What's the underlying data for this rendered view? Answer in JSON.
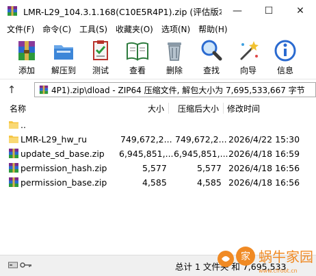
{
  "window": {
    "title": "LMR-L29_104.3.1.168(C10E5R4P1).zip (评估版本)",
    "minimize_glyph": "—",
    "maximize_glyph": "☐",
    "close_glyph": "✕"
  },
  "menu": [
    {
      "label": "文件(F)"
    },
    {
      "label": "命令(C)"
    },
    {
      "label": "工具(S)"
    },
    {
      "label": "收藏夹(O)"
    },
    {
      "label": "选项(N)"
    },
    {
      "label": "帮助(H)"
    }
  ],
  "toolbar": [
    {
      "label": "添加",
      "icon": "add-archive-icon"
    },
    {
      "label": "解压到",
      "icon": "extract-to-icon"
    },
    {
      "label": "测试",
      "icon": "test-icon"
    },
    {
      "label": "查看",
      "icon": "view-icon"
    },
    {
      "label": "删除",
      "icon": "delete-icon"
    },
    {
      "label": "查找",
      "icon": "find-icon"
    },
    {
      "label": "向导",
      "icon": "wizard-icon"
    },
    {
      "label": "信息",
      "icon": "info-icon"
    }
  ],
  "address": {
    "up_glyph": "↑",
    "path": "4P1).zip\\dload - ZIP64 压缩文件, 解包大小为 7,695,533,667 字节"
  },
  "columns": {
    "name": "名称",
    "size": "大小",
    "packed": "压缩后大小",
    "modified": "修改时间"
  },
  "files": [
    {
      "name": "..",
      "size": "",
      "packed": "",
      "modified": "",
      "type": "parent-folder"
    },
    {
      "name": "LMR-L29_hw_ru",
      "size": "749,672,2...",
      "packed": "749,672,2...",
      "modified": "2026/4/22 15:30",
      "type": "folder"
    },
    {
      "name": "update_sd_base.zip",
      "size": "6,945,851,...",
      "packed": "6,945,851,...",
      "modified": "2026/4/18 16:59",
      "type": "zip"
    },
    {
      "name": "permission_hash.zip",
      "size": "5,577",
      "packed": "5,577",
      "modified": "2026/4/18 16:56",
      "type": "zip"
    },
    {
      "name": "permission_base.zip",
      "size": "4,585",
      "packed": "4,585",
      "modified": "2026/4/18 16:56",
      "type": "zip"
    }
  ],
  "status": {
    "summary": "总计 1 文件夹 和 7,695,533"
  },
  "watermark": {
    "text": "蜗牛家园",
    "url": "www.cfroot.cn"
  },
  "colors": {
    "folder": "#F5C542",
    "accent_blue": "#1E6FD9",
    "watermark_orange": "#F08A24"
  }
}
